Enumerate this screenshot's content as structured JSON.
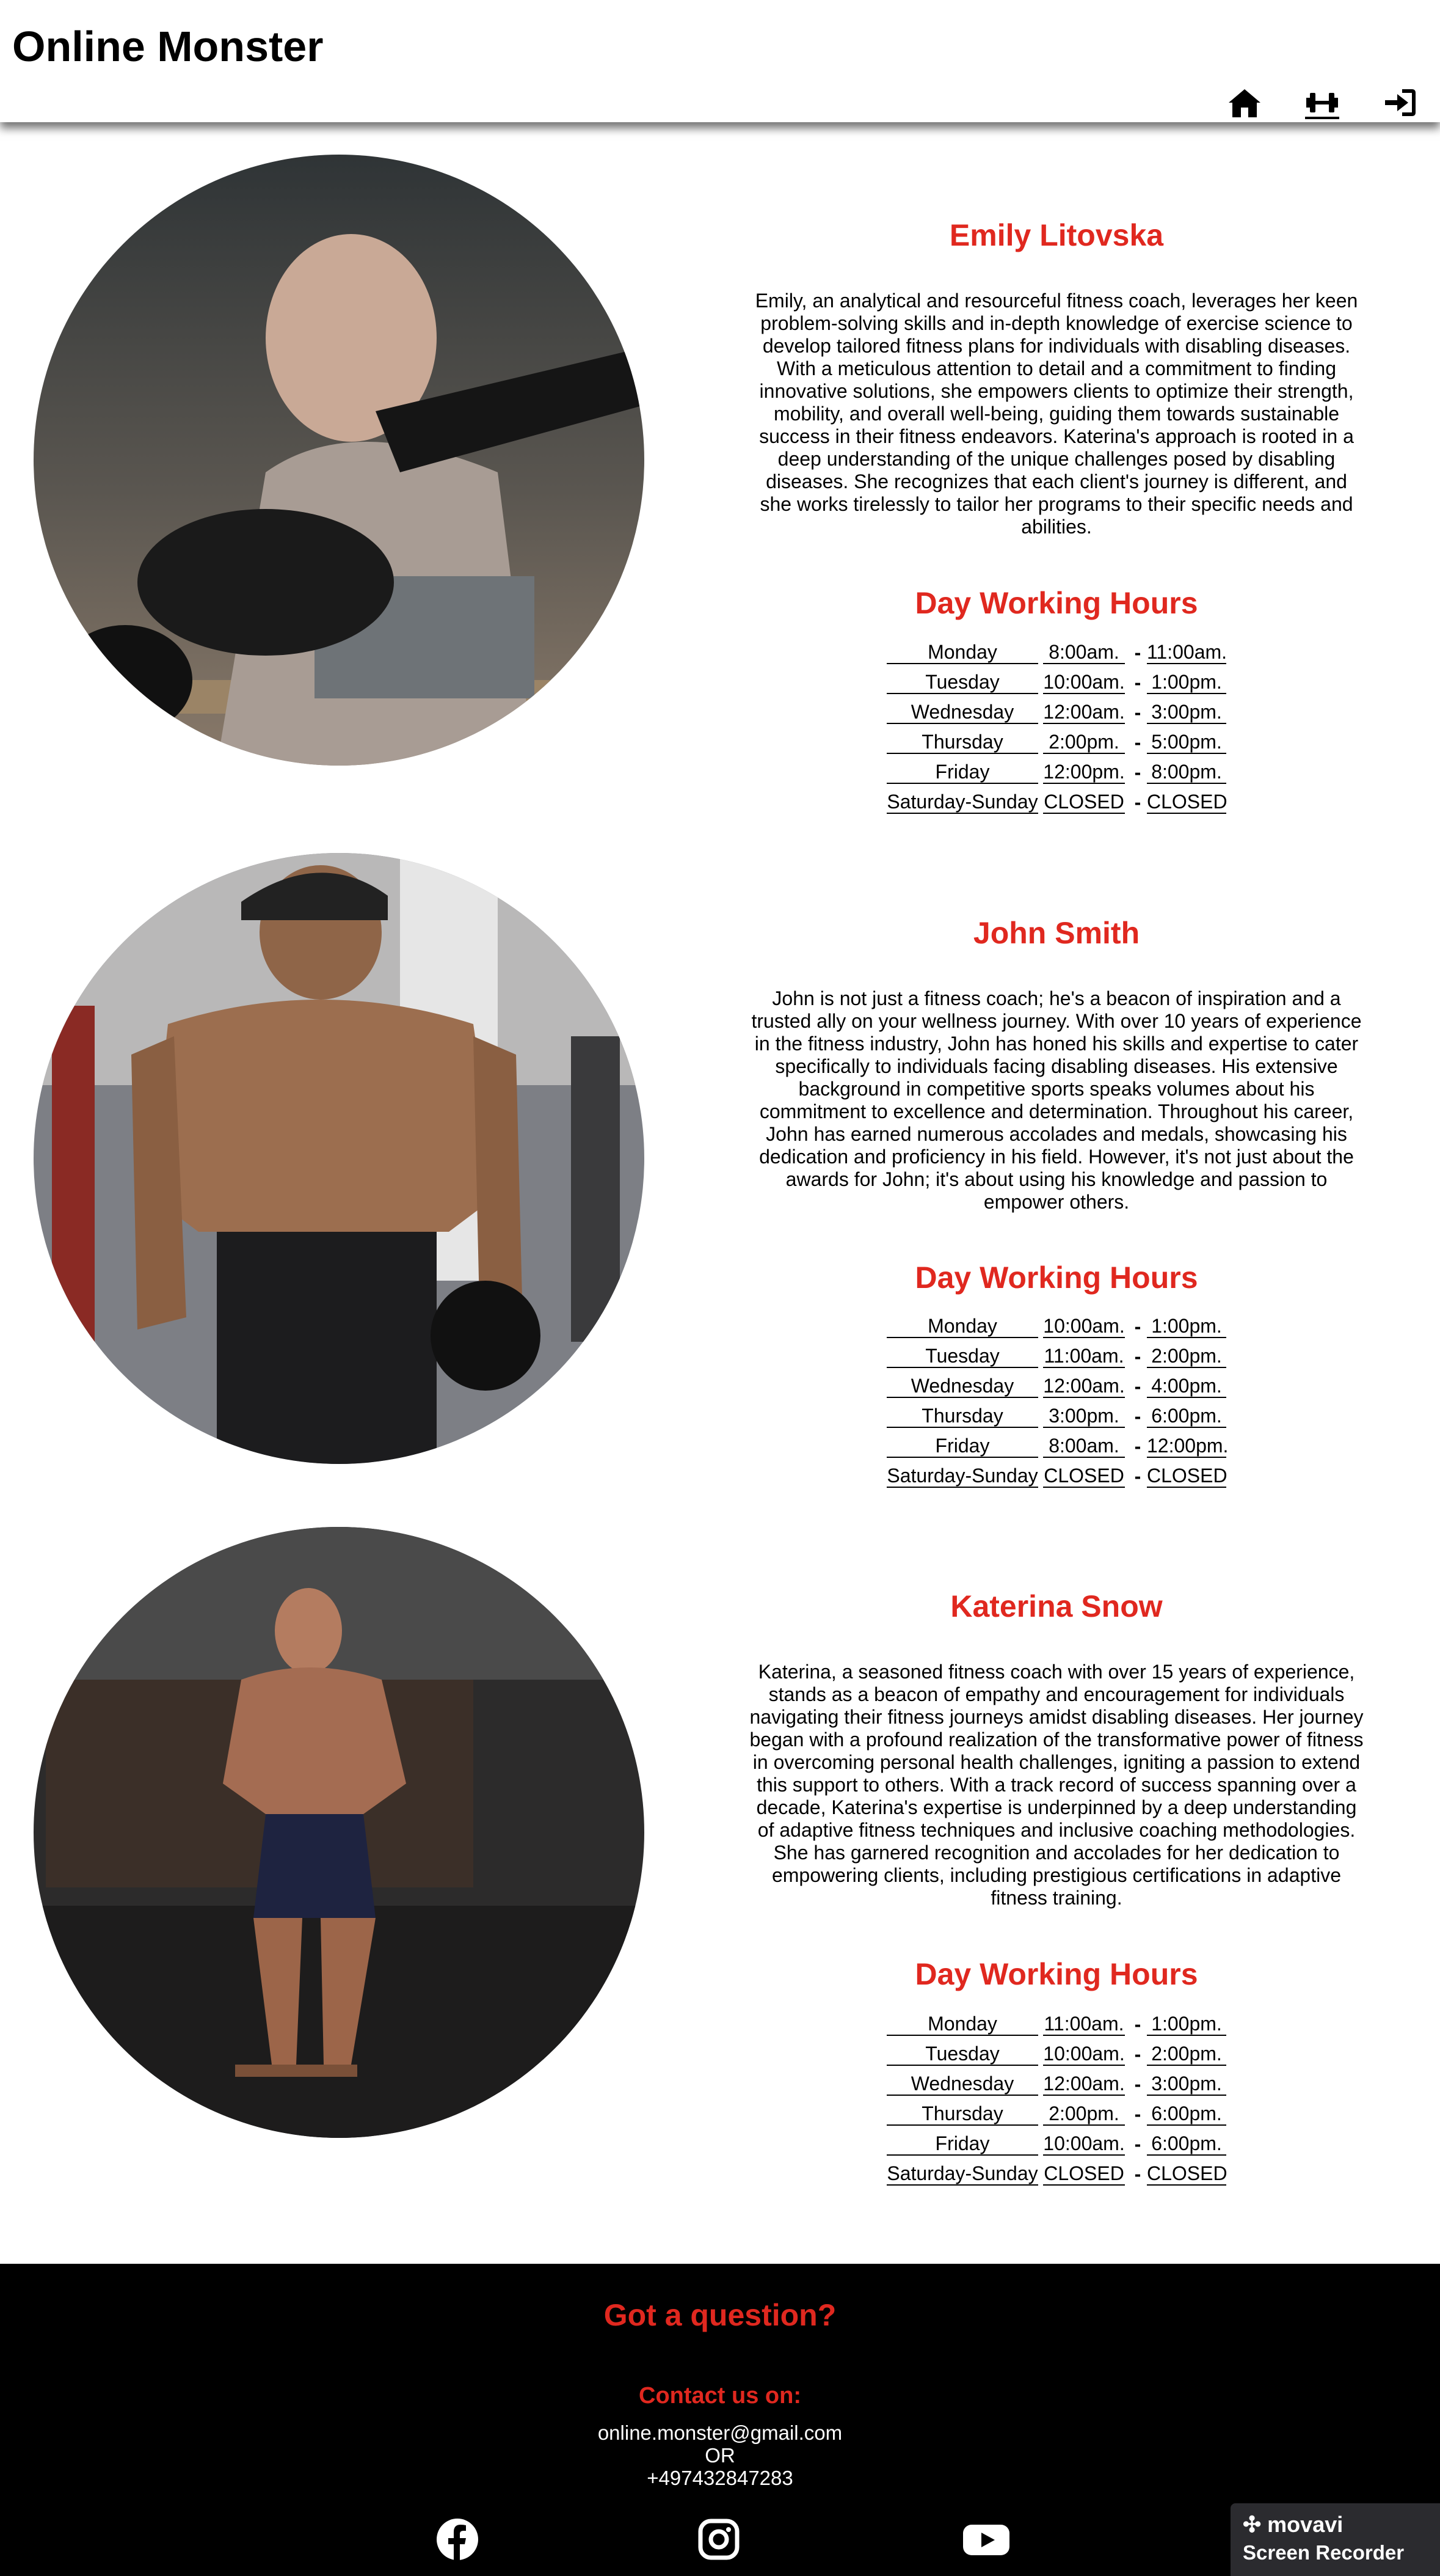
{
  "header": {
    "brand": "Online Monster"
  },
  "nav": [
    {
      "icon": "home-icon"
    },
    {
      "icon": "dumbbell-icon",
      "active": true
    },
    {
      "icon": "sign-in-icon"
    }
  ],
  "hours_title": "Day Working Hours",
  "dash": "-",
  "trainers": [
    {
      "name": "Emily Litovska",
      "bio": "Emily, an analytical and resourceful fitness coach, leverages her keen problem-solving skills and in-depth knowledge of exercise science to develop tailored fitness plans for individuals with disabling diseases. With a meticulous attention to detail and a commitment to finding innovative solutions, she empowers clients to optimize their strength, mobility, and overall well-being, guiding them towards sustainable success in their fitness endeavors. Katerina's approach is rooted in a deep understanding of the unique challenges posed by disabling diseases. She recognizes that each client's journey is different, and she works tirelessly to tailor her programs to their specific needs and abilities.",
      "hours": [
        {
          "day": "Monday",
          "open": "8:00am.",
          "close": "11:00am."
        },
        {
          "day": "Tuesday",
          "open": "10:00am.",
          "close": "1:00pm."
        },
        {
          "day": "Wednesday",
          "open": "12:00am.",
          "close": "3:00pm."
        },
        {
          "day": "Thursday",
          "open": "2:00pm.",
          "close": "5:00pm."
        },
        {
          "day": "Friday",
          "open": "12:00pm.",
          "close": "8:00pm."
        },
        {
          "day": "Saturday-Sunday",
          "open": "CLOSED",
          "close": "CLOSED"
        }
      ]
    },
    {
      "name": "John Smith",
      "bio": "John is not just a fitness coach; he's a beacon of inspiration and a trusted ally on your wellness journey. With over 10 years of experience in the fitness industry, John has honed his skills and expertise to cater specifically to individuals facing disabling diseases. His extensive background in competitive sports speaks volumes about his commitment to excellence and determination. Throughout his career, John has earned numerous accolades and medals, showcasing his dedication and proficiency in his field. However, it's not just about the awards for John; it's about using his knowledge and passion to empower others.",
      "hours": [
        {
          "day": "Monday",
          "open": "10:00am.",
          "close": "1:00pm."
        },
        {
          "day": "Tuesday",
          "open": "11:00am.",
          "close": "2:00pm."
        },
        {
          "day": "Wednesday",
          "open": "12:00am.",
          "close": "4:00pm."
        },
        {
          "day": "Thursday",
          "open": "3:00pm.",
          "close": "6:00pm."
        },
        {
          "day": "Friday",
          "open": "8:00am.",
          "close": "12:00pm."
        },
        {
          "day": "Saturday-Sunday",
          "open": "CLOSED",
          "close": "CLOSED"
        }
      ]
    },
    {
      "name": "Katerina Snow",
      "bio": "Katerina, a seasoned fitness coach with over 15 years of experience, stands as a beacon of empathy and encouragement for individuals navigating their fitness journeys amidst disabling diseases. Her journey began with a profound realization of the transformative power of fitness in overcoming personal health challenges, igniting a passion to extend this support to others. With a track record of success spanning over a decade, Katerina's expertise is underpinned by a deep understanding of adaptive fitness techniques and inclusive coaching methodologies. She has garnered recognition and accolades for her dedication to empowering clients, including prestigious certifications in adaptive fitness training.",
      "hours": [
        {
          "day": "Monday",
          "open": "11:00am.",
          "close": "1:00pm."
        },
        {
          "day": "Tuesday",
          "open": "10:00am.",
          "close": "2:00pm."
        },
        {
          "day": "Wednesday",
          "open": "12:00am.",
          "close": "3:00pm."
        },
        {
          "day": "Thursday",
          "open": "2:00pm.",
          "close": "6:00pm."
        },
        {
          "day": "Friday",
          "open": "10:00am.",
          "close": "6:00pm."
        },
        {
          "day": "Saturday-Sunday",
          "open": "CLOSED",
          "close": "CLOSED"
        }
      ]
    }
  ],
  "footer": {
    "title": "Got a question?",
    "contact_label": "Contact us on:",
    "email": "online.monster@gmail.com",
    "or": "OR",
    "phone": "+497432847283",
    "social": [
      "facebook-icon",
      "instagram-icon",
      "youtube-icon"
    ]
  },
  "watermark": {
    "logo": "movavi",
    "text": "Screen Recorder"
  },
  "colors": {
    "accent": "#e0281f",
    "footer_bg": "#000000"
  }
}
